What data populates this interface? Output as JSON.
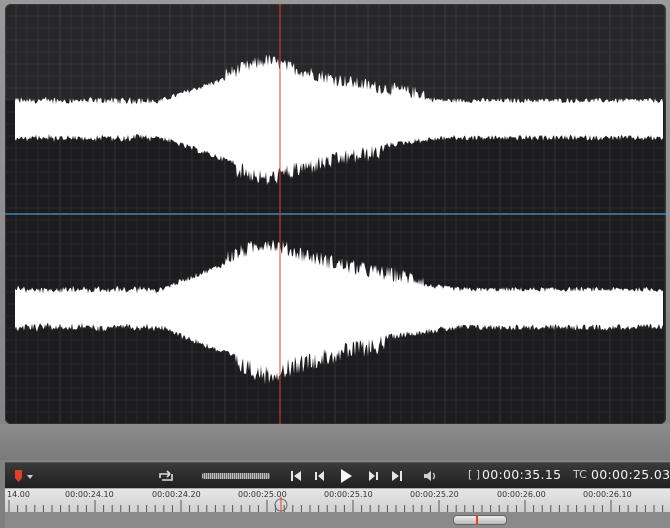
{
  "ruler": {
    "labels": [
      "14.00",
      "00:00:24.10",
      "00:00:24.20",
      "00:00:25.00",
      "00:00:25.10",
      "00:00:25.20",
      "00:00:26.00",
      "00:00:26.10"
    ]
  },
  "transport": {
    "duration_icon": "[ ]",
    "duration": "00:00:35.15",
    "tc_label": "TC",
    "timecode": "00:00:25.03",
    "buttons": [
      "marker-icon",
      "loop-icon",
      "go-to-start-icon",
      "step-back-icon",
      "play-icon",
      "step-forward-icon",
      "go-to-end-icon",
      "volume-icon"
    ]
  },
  "colors": {
    "playhead": "#e0402a",
    "waveform": "#ffffff",
    "background": "#1c1c1f",
    "channel_divider": "#3c6a8c"
  },
  "waveform": {
    "channels": 2,
    "playhead_time": "00:00:25.03"
  }
}
